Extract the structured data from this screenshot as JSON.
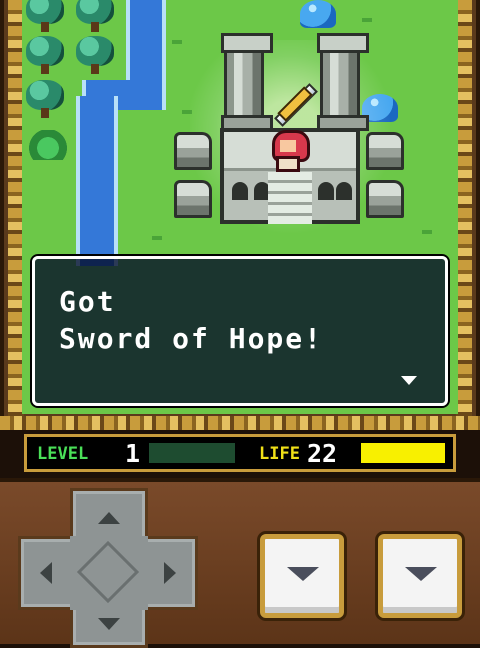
{
  "dialog": {
    "message": "Got\nSword of Hope!",
    "next_indicator_icon": "triangle-down-icon"
  },
  "status": {
    "level_label": "LEVEL",
    "level_value": "1",
    "exp_fraction": 0,
    "life_label": "LIFE",
    "life_value": "22",
    "life_fraction": 1.0,
    "colors": {
      "level_label": "#4ae058",
      "life_label": "#f0e018",
      "life_bar": "#f8f000",
      "exp_bar_bg": "#1e4c30"
    }
  },
  "controls": {
    "dpad_icons": [
      "arrow-up-icon",
      "arrow-down-icon",
      "arrow-left-icon",
      "arrow-right-icon"
    ],
    "action_buttons": [
      {
        "name": "action-button-a",
        "icon": "triangle-down-icon"
      },
      {
        "name": "action-button-b",
        "icon": "triangle-down-icon"
      }
    ]
  }
}
